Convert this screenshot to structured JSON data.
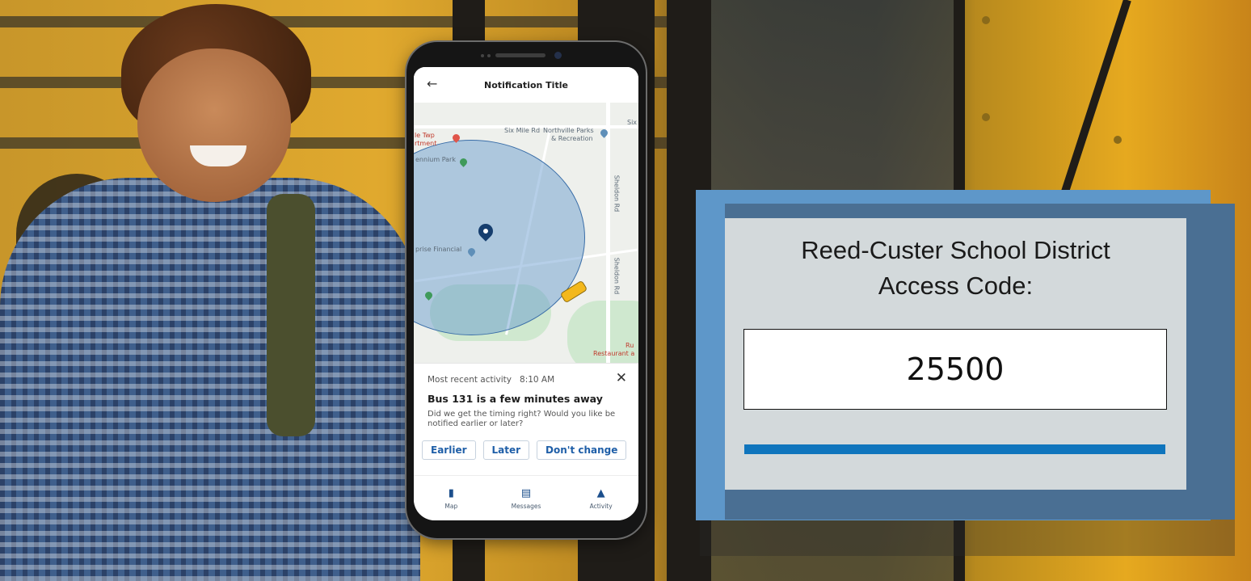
{
  "phone": {
    "header_title": "Notification Title",
    "map": {
      "labels": [
        "Six Mile Rd",
        "Northville Parks",
        "& Recreation",
        "le Twp",
        "rtment",
        "ennium Park",
        "prise Financial",
        "Sheldon Rd",
        "Sheldon Rd",
        "Ru",
        "Restaurant a",
        "Six"
      ]
    },
    "sheet": {
      "recent_label": "Most recent activity",
      "recent_time": "8:10 AM",
      "headline": "Bus 131 is a few minutes away",
      "body": "Did we get the timing right? Would you like be notified earlier or later?",
      "buttons": [
        "Earlier",
        "Later",
        "Don't change"
      ]
    },
    "tabs": [
      "Map",
      "Messages",
      "Activity"
    ]
  },
  "card": {
    "district_line1": "Reed-Custer School District",
    "district_line2": "Access Code:",
    "code": "25500"
  },
  "colors": {
    "card_blue": "#5e97c9",
    "card_navy": "#4a6f93",
    "card_panel": "#d3d9db",
    "accent_bar": "#0f75bd",
    "button_text": "#1f5fa8"
  }
}
